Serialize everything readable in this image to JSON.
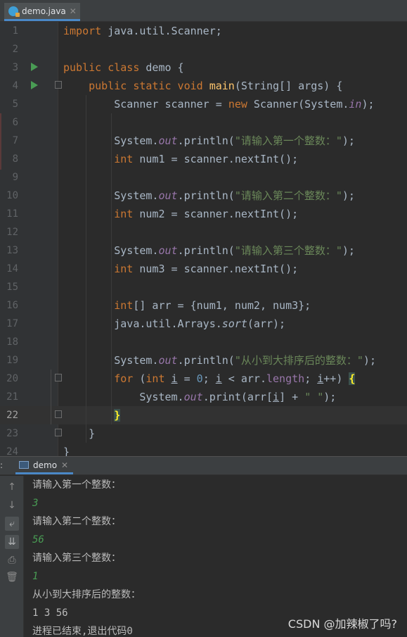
{
  "editor_tab": {
    "label": "demo.java",
    "close": "✕"
  },
  "code_lines": [
    {
      "n": "1",
      "html": "<span class='kw'>import</span> java.util.Scanner;"
    },
    {
      "n": "2",
      "html": ""
    },
    {
      "n": "3",
      "html": "<span class='kw'>public class</span> demo {"
    },
    {
      "n": "4",
      "html": "    <span class='kw'>public static void</span> <span class='fn'>main</span>(String[] args) {"
    },
    {
      "n": "5",
      "html": "        Scanner scanner = <span class='kw'>new</span> Scanner(System.<span class='fld'>in</span>);"
    },
    {
      "n": "6",
      "html": ""
    },
    {
      "n": "7",
      "html": "        System.<span class='fld'>out</span>.println(<span class='st'>\"请输入第一个整数：\"</span>);"
    },
    {
      "n": "8",
      "html": "        <span class='kw'>int</span> num1 = scanner.nextInt();"
    },
    {
      "n": "9",
      "html": ""
    },
    {
      "n": "10",
      "html": "        System.<span class='fld'>out</span>.println(<span class='st'>\"请输入第二个整数：\"</span>);"
    },
    {
      "n": "11",
      "html": "        <span class='kw'>int</span> num2 = scanner.nextInt();"
    },
    {
      "n": "12",
      "html": ""
    },
    {
      "n": "13",
      "html": "        System.<span class='fld'>out</span>.println(<span class='st'>\"请输入第三个整数：\"</span>);"
    },
    {
      "n": "14",
      "html": "        <span class='kw'>int</span> num3 = scanner.nextInt();"
    },
    {
      "n": "15",
      "html": ""
    },
    {
      "n": "16",
      "html": "        <span class='kw'>int</span>[] arr = {num1, num2, num3};"
    },
    {
      "n": "17",
      "html": "        java.util.Arrays.<span class='ital'>sort</span>(arr);"
    },
    {
      "n": "18",
      "html": ""
    },
    {
      "n": "19",
      "html": "        System.<span class='fld'>out</span>.println(<span class='st'>\"从小到大排序后的整数：\"</span>);"
    },
    {
      "n": "20",
      "html": "        <span class='kw'>for</span> (<span class='kw'>int</span> <span class='ul'>i</span> = <span class='num'>0</span>; <span class='ul'>i</span> &lt; arr.<span class='fld' style='font-style:normal'>length</span>; <span class='ul'>i</span>++) <span class='brace-hl'>{</span>"
    },
    {
      "n": "21",
      "html": "            System.<span class='fld'>out</span>.print(arr[<span class='ul'>i</span>] + <span class='st'>\" \"</span>);"
    },
    {
      "n": "22",
      "html": "        <span class='brace-hl'>}</span>"
    },
    {
      "n": "23",
      "html": "    }"
    },
    {
      "n": "24",
      "html": "}"
    }
  ],
  "run_panel": {
    "edge_label": "​:",
    "tab_label": "demo",
    "tab_close": "✕"
  },
  "toolbar_icons": [
    "up-arrow-icon",
    "down-arrow-icon",
    "soft-wrap-icon",
    "scroll-to-end-icon",
    "print-icon",
    "trash-icon"
  ],
  "console_lines": [
    {
      "text": "请输入第一个整数：",
      "input": false
    },
    {
      "text": "3",
      "input": true
    },
    {
      "text": "请输入第二个整数：",
      "input": false
    },
    {
      "text": "56",
      "input": true
    },
    {
      "text": "请输入第三个整数：",
      "input": false
    },
    {
      "text": "1",
      "input": true
    },
    {
      "text": "从小到大排序后的整数：",
      "input": false
    },
    {
      "text": "1 3 56 ",
      "input": false
    },
    {
      "text": "进程已结束,退出代码0",
      "input": false
    }
  ],
  "watermark": "CSDN @加辣椒了吗?",
  "colors": {
    "keyword": "#cc7832",
    "string": "#6a8759",
    "field": "#9876aa",
    "number": "#6897bb",
    "method": "#ffc66d",
    "run_arrow": "#499c54",
    "console_input": "#499c54"
  }
}
